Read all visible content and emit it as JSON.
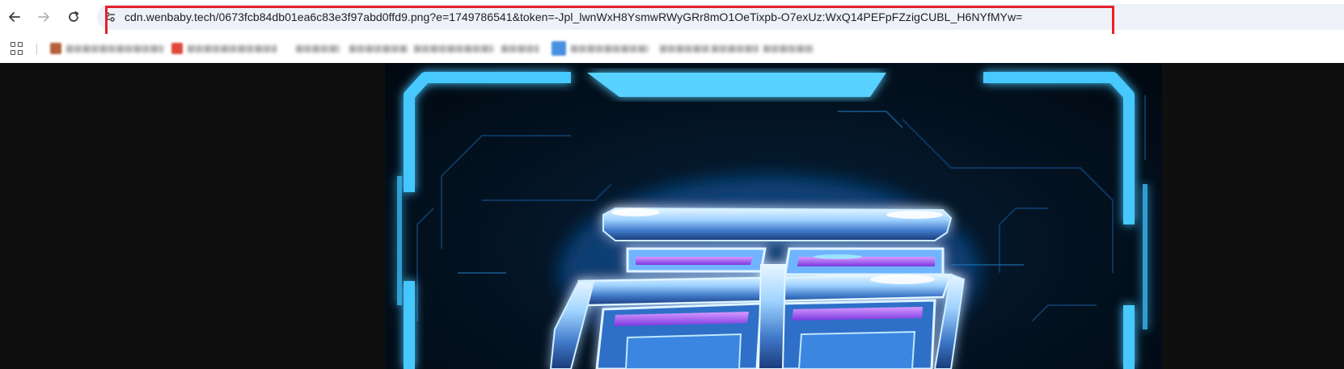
{
  "toolbar": {
    "back_icon": "arrow-left-icon",
    "forward_icon": "arrow-right-icon",
    "reload_icon": "reload-icon",
    "site_info_icon": "tune-icon",
    "url": "cdn.wenbaby.tech/0673fcb84db01ea6c83e3f97abd0ffd9.png?e=1749786541&token=-Jpl_lwnWxH8YsmwRWyGRr8mO1OeTixpb-O7exUz:WxQ14PEFpFZzigCUBL_H6NYfMYw=",
    "highlight_color": "#e5202a"
  },
  "bookmarks_bar": {
    "apps_icon": "apps-grid-icon",
    "items_blurred": true,
    "favicon_colors": [
      "#b5603a",
      "#e0483c",
      "#4a90e2"
    ]
  },
  "viewer": {
    "background": "#0f0f10",
    "image_description_icon": "glowing-chinese-character-image",
    "accent_cyan": "#4fd0ff",
    "accent_purple": "#b36cff"
  }
}
